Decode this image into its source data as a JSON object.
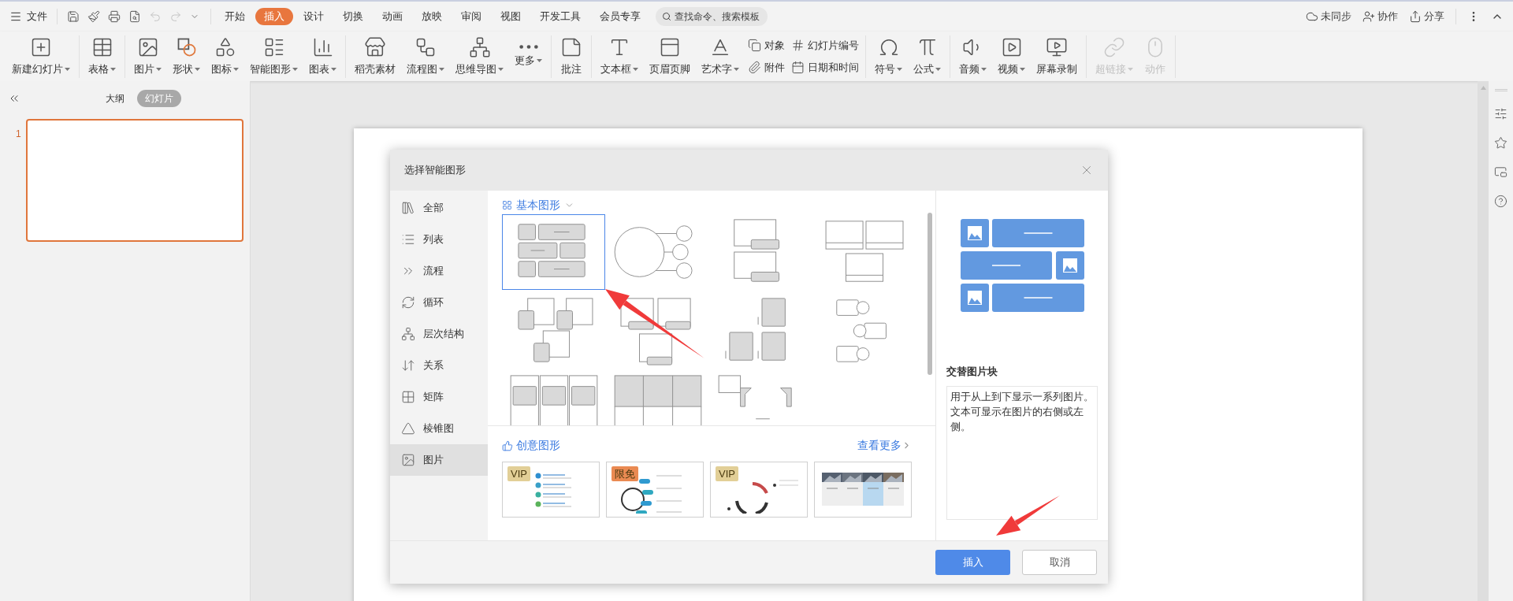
{
  "menu_bar": {
    "file_menu": "文件",
    "quick_access": [
      {
        "disabled": false
      },
      {
        "disabled": false
      },
      {
        "disabled": false
      },
      {
        "disabled": false
      },
      {
        "disabled": true
      },
      {
        "disabled": true
      },
      {
        "disabled": false
      }
    ],
    "tabs": [
      {
        "label": "开始",
        "selected": false
      },
      {
        "label": "插入",
        "selected": true
      },
      {
        "label": "设计",
        "selected": false
      },
      {
        "label": "切换",
        "selected": false
      },
      {
        "label": "动画",
        "selected": false
      },
      {
        "label": "放映",
        "selected": false
      },
      {
        "label": "审阅",
        "selected": false
      },
      {
        "label": "视图",
        "selected": false
      },
      {
        "label": "开发工具",
        "selected": false
      },
      {
        "label": "会员专享",
        "selected": false
      }
    ],
    "search": {
      "placeholder": "查找命令、搜索模板"
    },
    "right_actions": [
      "未同步",
      "协作",
      "分享"
    ]
  },
  "ribbon": {
    "groups": [
      {
        "items": [
          {
            "kind": "large",
            "label": "新建幻灯片",
            "has_menu": true,
            "disabled": false
          }
        ]
      },
      {
        "items": [
          {
            "kind": "large",
            "label": "表格",
            "has_menu": true,
            "disabled": false
          }
        ]
      },
      {
        "items": [
          {
            "kind": "large",
            "label": "图片",
            "has_menu": true,
            "disabled": false
          },
          {
            "kind": "large",
            "label": "形状",
            "has_menu": true,
            "disabled": false
          },
          {
            "kind": "large",
            "label": "图标",
            "has_menu": true,
            "disabled": false
          },
          {
            "kind": "large",
            "label": "智能图形",
            "has_menu": true,
            "disabled": false
          },
          {
            "kind": "large",
            "label": "图表",
            "has_menu": true,
            "disabled": false
          }
        ]
      },
      {
        "items": [
          {
            "kind": "large",
            "label": "稻壳素材",
            "has_menu": false,
            "disabled": false
          },
          {
            "kind": "large",
            "label": "流程图",
            "has_menu": true,
            "disabled": false
          },
          {
            "kind": "large",
            "label": "思维导图",
            "has_menu": true,
            "disabled": false
          },
          {
            "kind": "large",
            "label": "更多",
            "has_menu": true,
            "disabled": false
          }
        ]
      },
      {
        "items": [
          {
            "kind": "large",
            "label": "批注",
            "has_menu": false,
            "disabled": false
          }
        ]
      },
      {
        "items": [
          {
            "kind": "large",
            "label": "文本框",
            "has_menu": true,
            "disabled": false
          },
          {
            "kind": "large",
            "label": "页眉页脚",
            "has_menu": false,
            "disabled": false
          },
          {
            "kind": "large",
            "label": "艺术字",
            "has_menu": true,
            "disabled": false
          },
          {
            "kind": "stack",
            "items": [
              {
                "label": "对象"
              },
              {
                "label": "附件"
              }
            ]
          },
          {
            "kind": "stack",
            "items": [
              {
                "label": "幻灯片编号"
              },
              {
                "label": "日期和时间"
              }
            ]
          }
        ]
      },
      {
        "items": [
          {
            "kind": "large",
            "label": "符号",
            "has_menu": true,
            "disabled": false
          },
          {
            "kind": "large",
            "label": "公式",
            "has_menu": true,
            "disabled": false
          }
        ]
      },
      {
        "items": [
          {
            "kind": "large",
            "label": "音频",
            "has_menu": true,
            "disabled": false
          },
          {
            "kind": "large",
            "label": "视频",
            "has_menu": true,
            "disabled": false
          },
          {
            "kind": "large",
            "label": "屏幕录制",
            "has_menu": false,
            "disabled": false
          }
        ]
      },
      {
        "items": [
          {
            "kind": "large",
            "label": "超链接",
            "has_menu": true,
            "disabled": true
          },
          {
            "kind": "large",
            "label": "动作",
            "has_menu": false,
            "disabled": true
          }
        ]
      }
    ]
  },
  "slide_panel": {
    "views": [
      {
        "label": "大纲",
        "selected": false
      },
      {
        "label": "幻灯片",
        "selected": true
      }
    ],
    "slides": [
      {
        "number": "1",
        "selected": true
      }
    ]
  },
  "dialog": {
    "title": "选择智能图形",
    "categories": [
      {
        "label": "全部",
        "selected": false
      },
      {
        "label": "列表",
        "selected": false
      },
      {
        "label": "流程",
        "selected": false
      },
      {
        "label": "循环",
        "selected": false
      },
      {
        "label": "层次结构",
        "selected": false
      },
      {
        "label": "关系",
        "selected": false
      },
      {
        "label": "矩阵",
        "selected": false
      },
      {
        "label": "棱锥图",
        "selected": false
      },
      {
        "label": "图片",
        "selected": true
      }
    ],
    "section_title": "基本图形",
    "layouts": [
      {
        "selected": true
      },
      {
        "selected": false
      },
      {
        "selected": false
      },
      {
        "selected": false
      },
      {
        "selected": false
      },
      {
        "selected": false
      },
      {
        "selected": false
      },
      {
        "selected": false
      },
      {
        "selected": false
      },
      {
        "selected": false
      },
      {
        "selected": false
      }
    ],
    "creative": {
      "title": "创意图形",
      "more_link": "查看更多",
      "templates": [
        {
          "kind": "steps",
          "badge": "VIP",
          "color": "#e2cf97"
        },
        {
          "kind": "hub",
          "badge": "限免",
          "color": "#ea8a52"
        },
        {
          "kind": "cycle",
          "badge": "VIP",
          "color": "#e2cf97"
        },
        {
          "kind": "photos"
        }
      ]
    },
    "preview": {
      "name": "交替图片块",
      "description": "用于从上到下显示一系列图片。文本可显示在图片的右侧或左侧。"
    },
    "buttons": [
      {
        "label": "插入",
        "kind": "primary"
      },
      {
        "label": "取消",
        "kind": "secondary"
      }
    ]
  }
}
